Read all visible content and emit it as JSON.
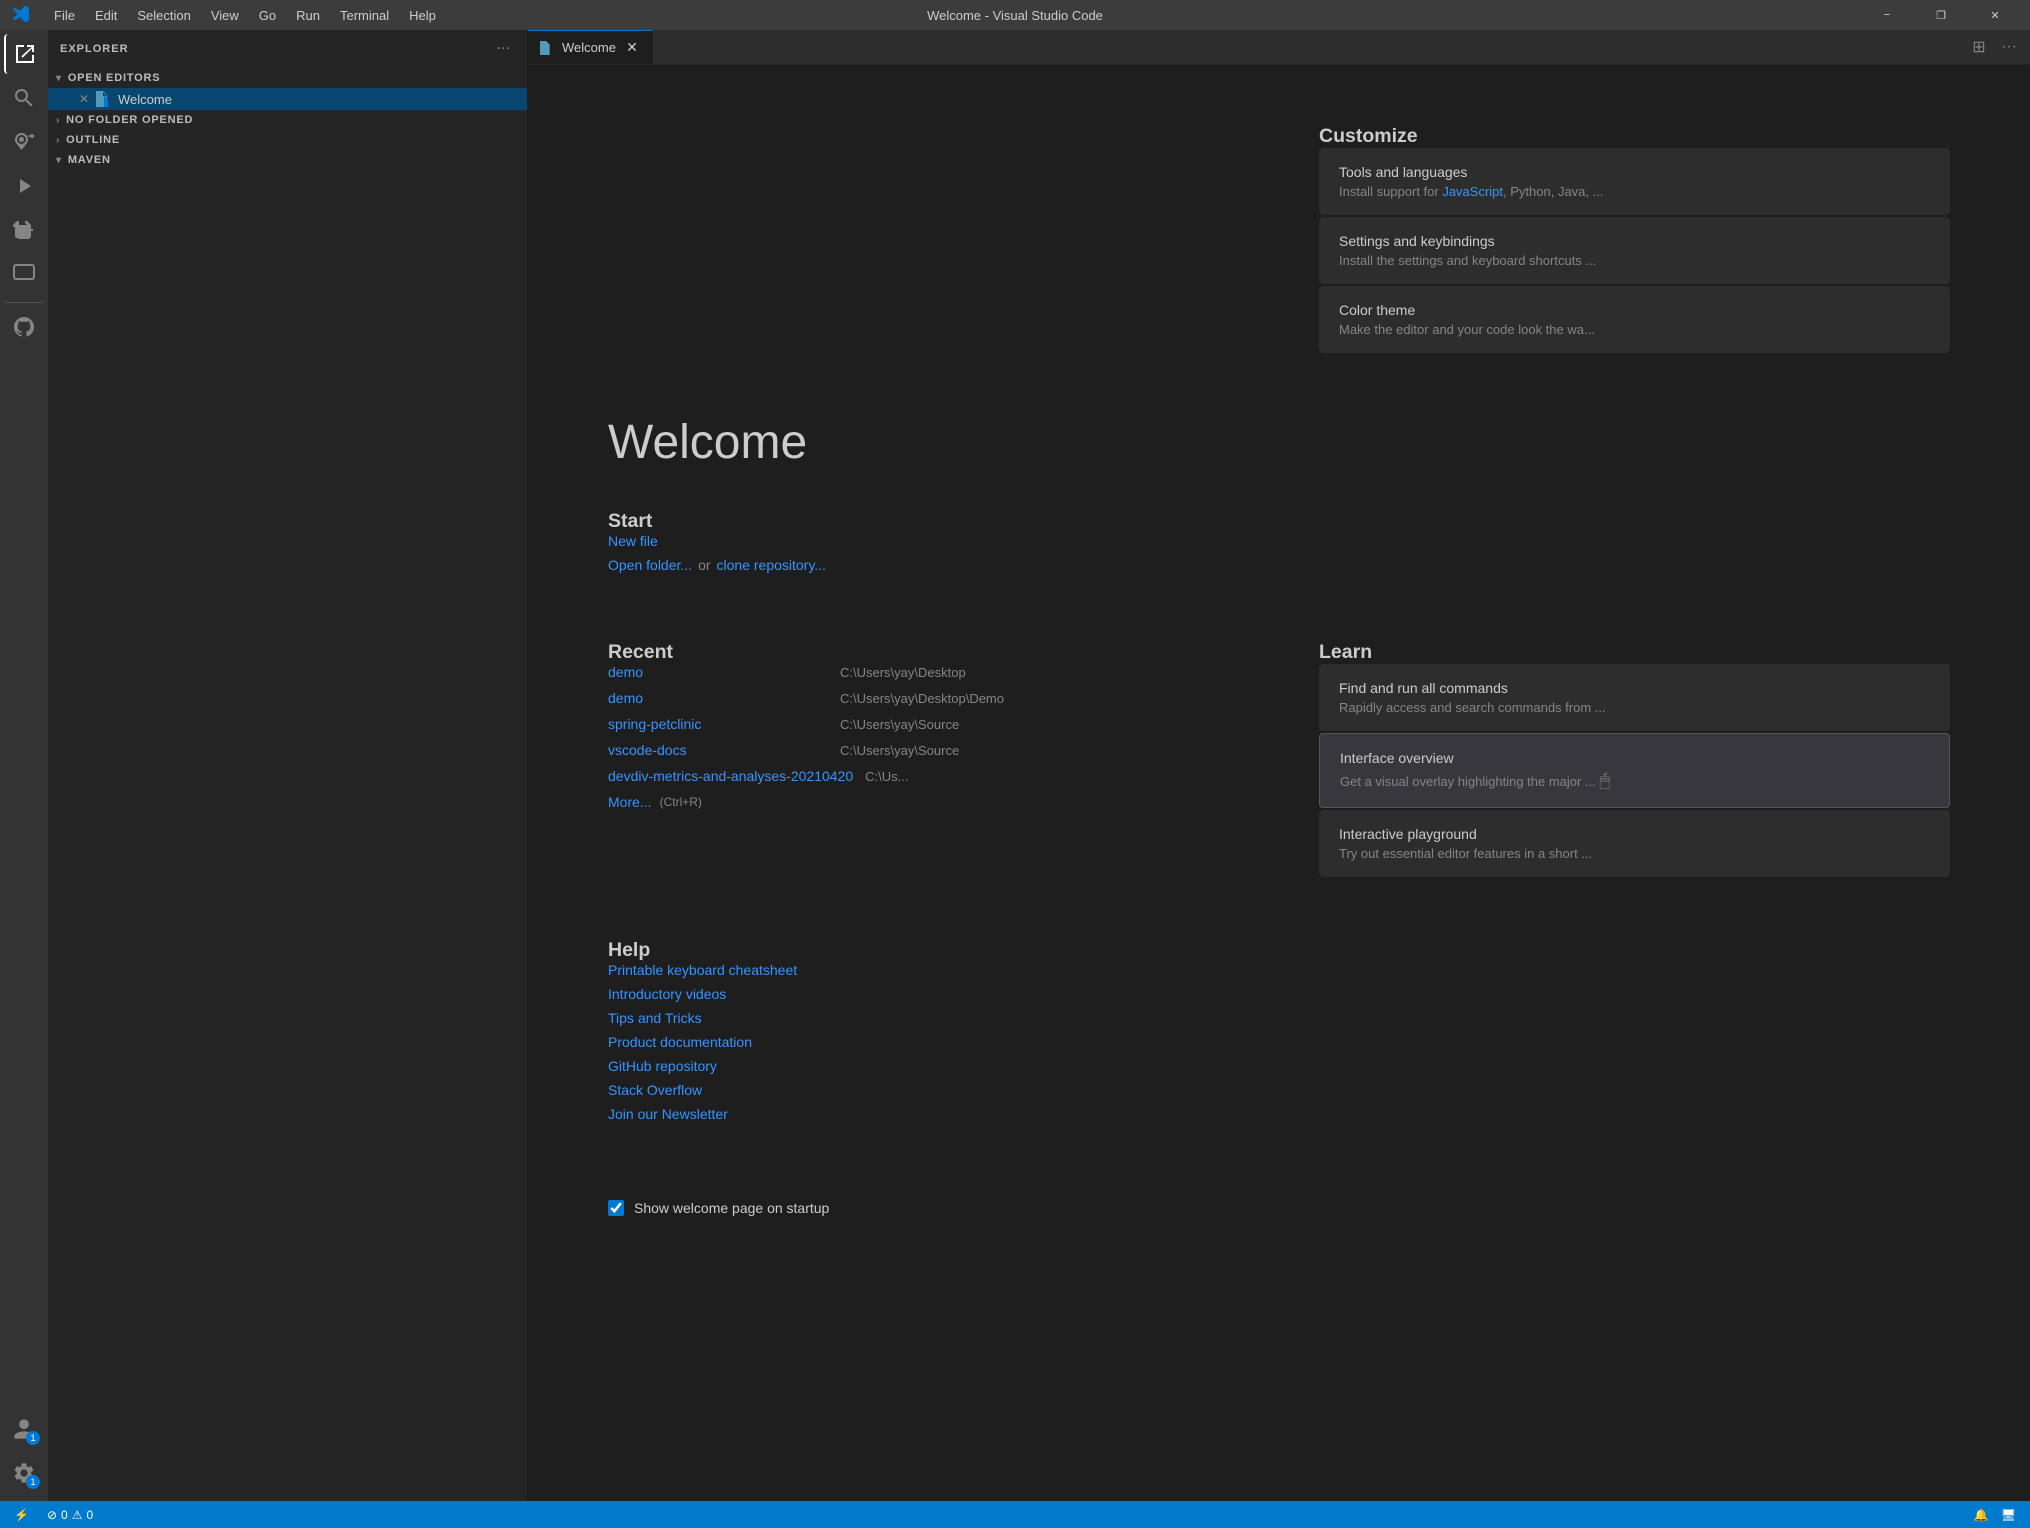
{
  "titlebar": {
    "title": "Welcome - Visual Studio Code",
    "menu": [
      "File",
      "Edit",
      "Selection",
      "View",
      "Go",
      "Run",
      "Terminal",
      "Help"
    ],
    "windowButtons": [
      "−",
      "❐",
      "✕"
    ]
  },
  "activityBar": {
    "icons": [
      {
        "name": "explorer-icon",
        "symbol": "⧉",
        "active": true
      },
      {
        "name": "search-icon",
        "symbol": "🔍",
        "active": false
      },
      {
        "name": "source-control-icon",
        "symbol": "⑂",
        "active": false
      },
      {
        "name": "run-debug-icon",
        "symbol": "▷",
        "active": false
      },
      {
        "name": "extensions-icon",
        "symbol": "⊞",
        "active": false
      },
      {
        "name": "remote-explorer-icon",
        "symbol": "🖥",
        "active": false
      },
      {
        "name": "github-icon",
        "symbol": "⬡",
        "active": false
      }
    ],
    "bottomIcons": [
      {
        "name": "accounts-icon",
        "symbol": "👤",
        "badge": "1"
      },
      {
        "name": "settings-icon",
        "symbol": "⚙",
        "badge": "1"
      }
    ]
  },
  "sidebar": {
    "title": "Explorer",
    "sections": {
      "openEditors": {
        "label": "Open Editors",
        "collapsed": false,
        "items": [
          {
            "icon": "vscode-icon",
            "label": "Welcome",
            "active": true
          }
        ]
      },
      "noFolder": {
        "label": "No Folder Opened",
        "collapsed": true
      },
      "outline": {
        "label": "Outline",
        "collapsed": true
      },
      "maven": {
        "label": "Maven",
        "collapsed": false
      }
    }
  },
  "tabs": [
    {
      "icon": "vscode-icon",
      "label": "Welcome",
      "active": true,
      "closable": true
    }
  ],
  "welcome": {
    "title": "Welcome",
    "start": {
      "heading": "Start",
      "links": [
        {
          "label": "New file",
          "id": "new-file-link"
        },
        {
          "label": "Open folder...",
          "id": "open-folder-link"
        },
        {
          "separator": " or "
        },
        {
          "label": "clone repository...",
          "id": "clone-repo-link"
        }
      ]
    },
    "recent": {
      "heading": "Recent",
      "items": [
        {
          "name": "demo",
          "path": "C:\\Users\\yay\\Desktop"
        },
        {
          "name": "demo",
          "path": "C:\\Users\\yay\\Desktop\\Demo"
        },
        {
          "name": "spring-petclinic",
          "path": "C:\\Users\\yay\\Source"
        },
        {
          "name": "vscode-docs",
          "path": "C:\\Users\\yay\\Source"
        },
        {
          "name": "devdiv-metrics-and-analyses-20210420",
          "path": "C:\\Us..."
        }
      ],
      "moreLabel": "More...",
      "moreShortcut": "(Ctrl+R)"
    },
    "help": {
      "heading": "Help",
      "links": [
        {
          "label": "Printable keyboard cheatsheet"
        },
        {
          "label": "Introductory videos"
        },
        {
          "label": "Tips and Tricks"
        },
        {
          "label": "Product documentation"
        },
        {
          "label": "GitHub repository"
        },
        {
          "label": "Stack Overflow"
        },
        {
          "label": "Join our Newsletter"
        }
      ]
    },
    "customize": {
      "heading": "Customize",
      "cards": [
        {
          "title": "Tools and languages",
          "description": "Install support for ",
          "highlight": "JavaScript",
          "descriptionEnd": ", Python, Java, ..."
        },
        {
          "title": "Settings and keybindings",
          "description": "Install the settings and keyboard shortcuts ..."
        },
        {
          "title": "Color theme",
          "description": "Make the editor and your code look the wa..."
        }
      ]
    },
    "learn": {
      "heading": "Learn",
      "cards": [
        {
          "title": "Find and run all commands",
          "description": "Rapidly access and search commands from ..."
        },
        {
          "title": "Interface overview",
          "description": "Get a visual overlay highlighting the major ...",
          "active": true
        },
        {
          "title": "Interactive playground",
          "description": "Try out essential editor features in a short ..."
        }
      ]
    },
    "startup": {
      "checked": true,
      "label": "Show welcome page on startup"
    }
  },
  "statusbar": {
    "left": [
      {
        "label": "⚡",
        "text": ""
      },
      {
        "label": "⓪ 0",
        "text": ""
      },
      {
        "label": "⚠ 0",
        "text": ""
      }
    ],
    "right": [
      {
        "label": "🔔"
      },
      {
        "label": "🖥"
      }
    ]
  }
}
